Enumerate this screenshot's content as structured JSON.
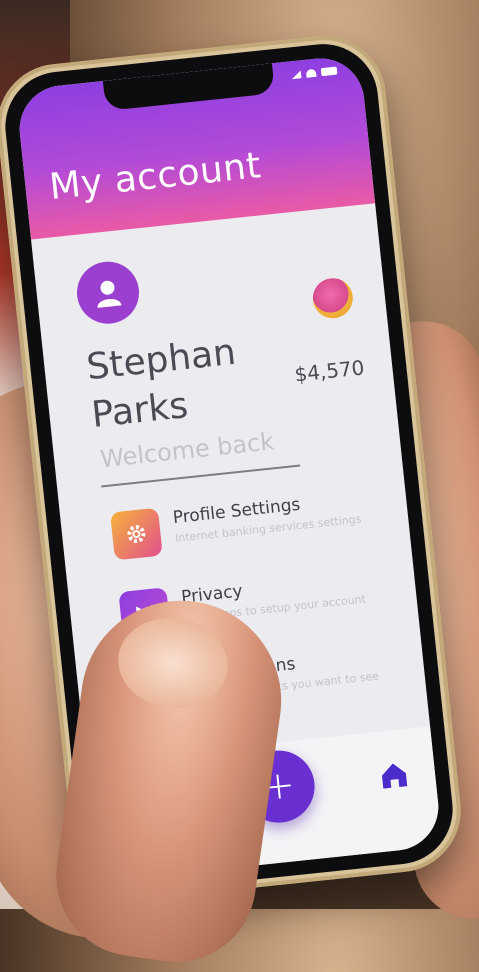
{
  "screen": {
    "title": "My account",
    "user": {
      "first_name": "Stephan",
      "last_name": "Parks",
      "welcome": "Welcome back",
      "balance": "$4,570"
    },
    "menu": [
      {
        "title": "Profile Settings",
        "subtitle": "Internet banking services settings",
        "icon": "gear-icon",
        "color": "#f2a23a"
      },
      {
        "title": "Privacy",
        "subtitle": "Easy steps to setup your account",
        "icon": "shield-icon",
        "color": "#7b3fe0"
      },
      {
        "title": "Notifications",
        "subtitle": "Choose the alerts you want to see",
        "icon": "bell-icon",
        "color": "#6a2fd0"
      }
    ],
    "tabbar": {
      "fab_icon": "plus-icon",
      "home_icon": "home-icon"
    }
  },
  "colors": {
    "header_start": "#8e3fe0",
    "header_end": "#e95aa6",
    "accent": "#6a2fd0"
  }
}
